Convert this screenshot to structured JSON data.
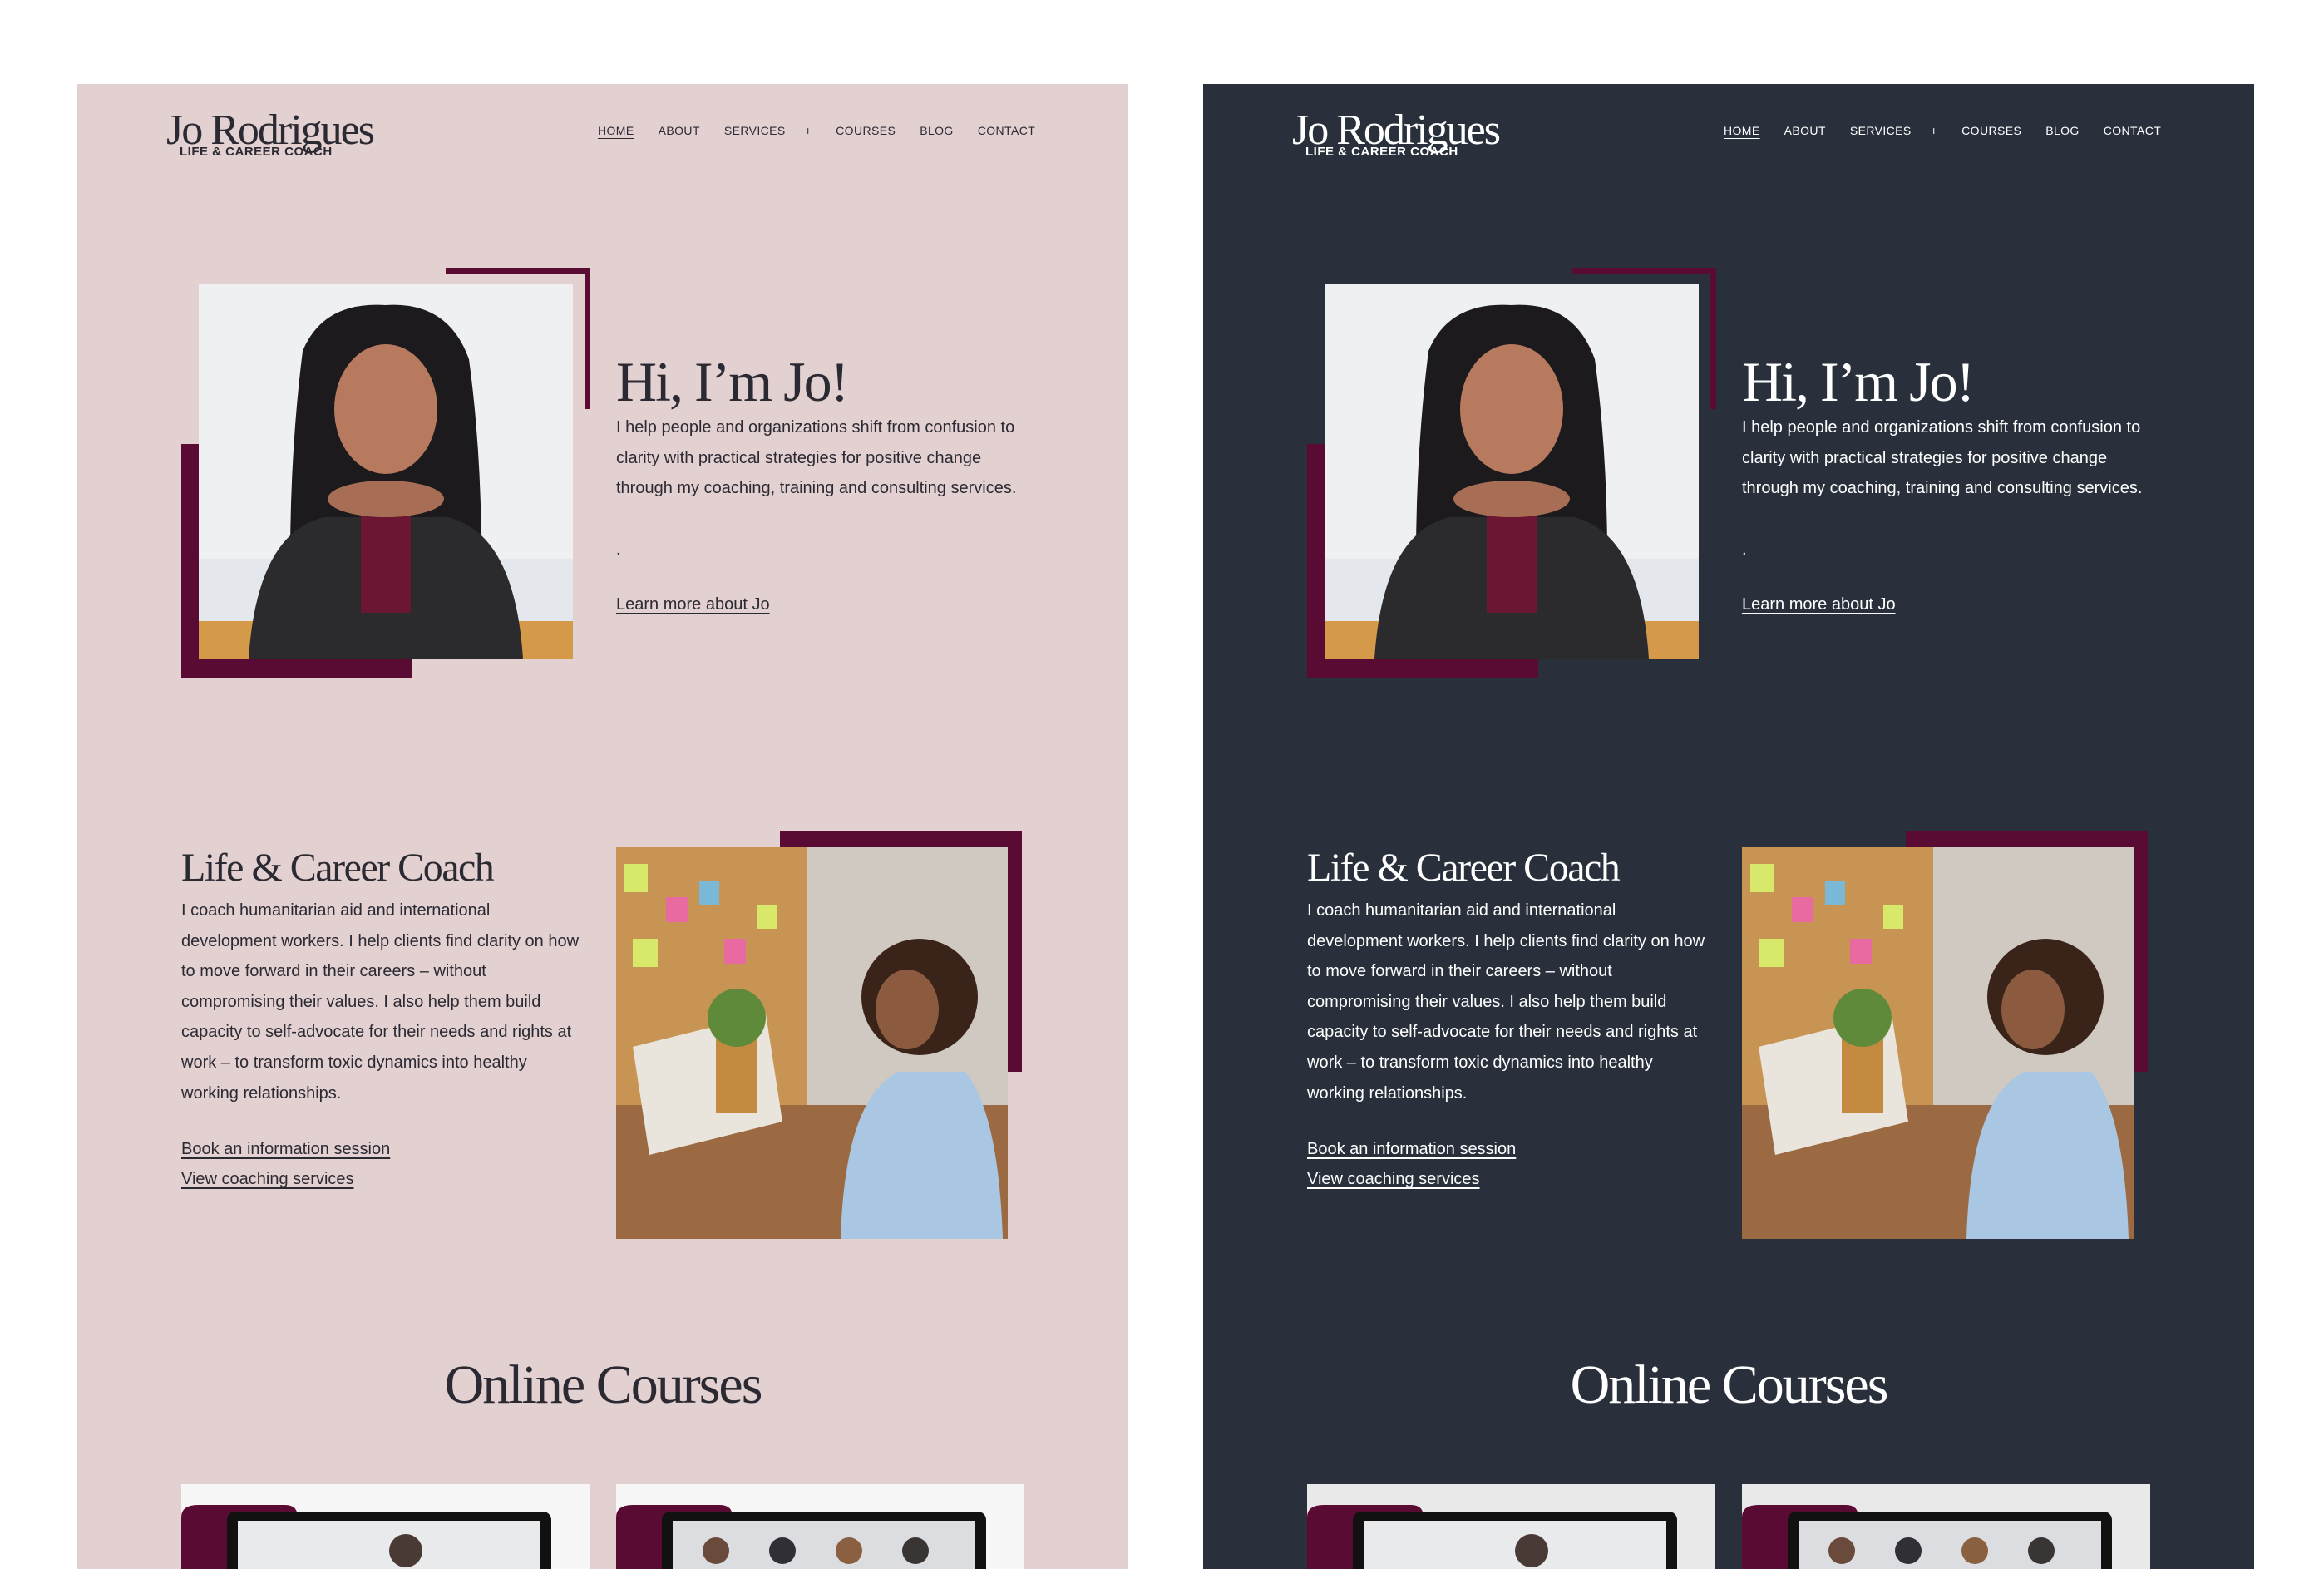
{
  "brand": {
    "name": "Jo Rodrigues",
    "tagline": "LIFE & CAREER COACH"
  },
  "nav": {
    "items": [
      "HOME",
      "ABOUT",
      "SERVICES",
      "+",
      "COURSES",
      "BLOG",
      "CONTACT"
    ],
    "active": "HOME"
  },
  "hero": {
    "title": "Hi, I’m Jo!",
    "text": "I help people and organizations shift from confusion to clarity with practical strategies for positive change through my coaching, training and consulting services.",
    "dot": ".",
    "link": "Learn more about Jo"
  },
  "coach": {
    "title": "Life & Career Coach",
    "text": "I coach humanitarian aid and international development workers. I help clients find clarity on how to move forward in their careers – without compromising their values. I also help them build capacity to self-advocate for their needs and rights at work – to transform toxic dynamics into healthy working relationships.",
    "link1": "Book an information session",
    "link2": "View coaching services"
  },
  "courses": {
    "title": "Online Courses"
  },
  "themes": {
    "light": {
      "background": "#e3d0d1",
      "text": "#2b2a33"
    },
    "dark": {
      "background": "#29303c",
      "text": "#ffffff"
    },
    "accent": "#5a0b33"
  },
  "icons": [
    "plus-icon"
  ]
}
